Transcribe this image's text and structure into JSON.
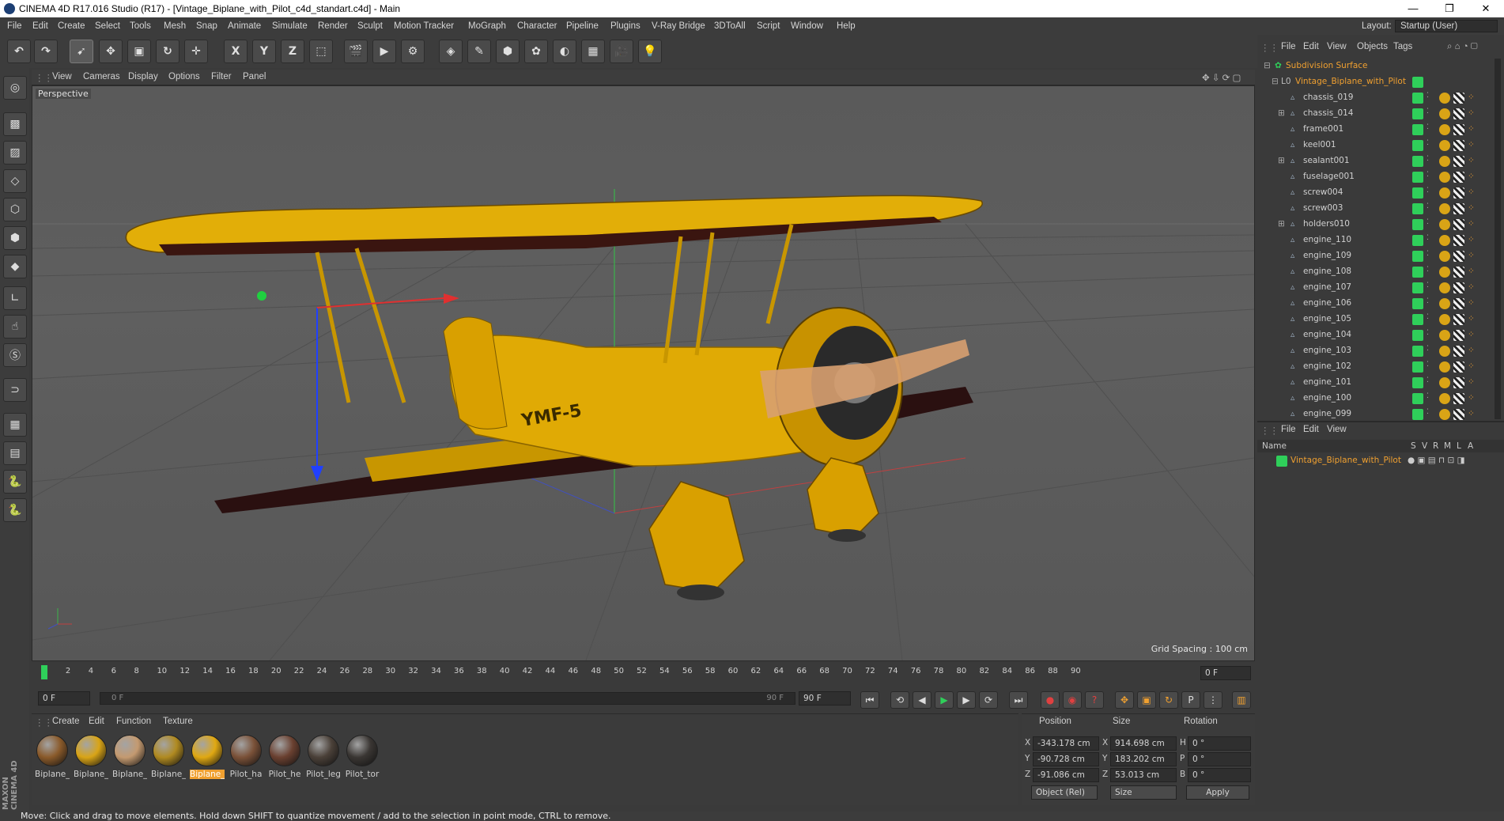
{
  "window": {
    "title": "CINEMA 4D R17.016 Studio (R17) - [Vintage_Biplane_with_Pilot_c4d_standart.c4d] - Main",
    "controls": [
      "—",
      "❐",
      "✕"
    ],
    "layout_label": "Layout:",
    "layout_value": "Startup (User)"
  },
  "menu": [
    "File",
    "Edit",
    "Create",
    "Select",
    "Tools",
    "Mesh",
    "Snap",
    "Animate",
    "Simulate",
    "Render",
    "Sculpt",
    "Motion Tracker",
    "MoGraph",
    "Character",
    "Pipeline",
    "Plugins",
    "V-Ray Bridge",
    "3DToAll",
    "Script",
    "Window",
    "Help"
  ],
  "viewport": {
    "menu": [
      "View",
      "Cameras",
      "Display",
      "Options",
      "Filter",
      "Panel"
    ],
    "label": "Perspective",
    "grid_spacing": "Grid Spacing : 100 cm",
    "plane_text": "YMF-5"
  },
  "timeline": {
    "ticks": [
      "0",
      "2",
      "4",
      "6",
      "8",
      "10",
      "12",
      "14",
      "16",
      "18",
      "20",
      "22",
      "24",
      "26",
      "28",
      "30",
      "32",
      "34",
      "36",
      "38",
      "40",
      "42",
      "44",
      "46",
      "48",
      "50",
      "52",
      "54",
      "56",
      "58",
      "60",
      "62",
      "64",
      "66",
      "68",
      "70",
      "72",
      "74",
      "76",
      "78",
      "80",
      "82",
      "84",
      "86",
      "88",
      "90"
    ],
    "current_frame": "0 F",
    "start": "0 F",
    "slider_start": "0 F",
    "slider_end": "90 F",
    "end": "90 F"
  },
  "materials": {
    "menu": [
      "Create",
      "Edit",
      "Function",
      "Texture"
    ],
    "items": [
      {
        "label": "Biplane_",
        "color": "#8a5a2a"
      },
      {
        "label": "Biplane_",
        "color": "#d9a416"
      },
      {
        "label": "Biplane_",
        "color": "#c49a70"
      },
      {
        "label": "Biplane_",
        "color": "#b08a20"
      },
      {
        "label": "Biplane_",
        "color": "#e0a812"
      },
      {
        "label": "Pilot_ha",
        "color": "#7a5138"
      },
      {
        "label": "Pilot_he",
        "color": "#6a4030"
      },
      {
        "label": "Pilot_leg",
        "color": "#4a4038"
      },
      {
        "label": "Pilot_tor",
        "color": "#3a3633"
      }
    ],
    "selected_index": 4
  },
  "coordinates": {
    "headers": [
      "Position",
      "Size",
      "Rotation"
    ],
    "rows": [
      {
        "axis": "X",
        "pos": "-343.178 cm",
        "size_axis": "X",
        "size": "914.698 cm",
        "rot_axis": "H",
        "rot": "0 °"
      },
      {
        "axis": "Y",
        "pos": "-90.728 cm",
        "size_axis": "Y",
        "size": "183.202 cm",
        "rot_axis": "P",
        "rot": "0 °"
      },
      {
        "axis": "Z",
        "pos": "-91.086 cm",
        "size_axis": "Z",
        "size": "53.013 cm",
        "rot_axis": "B",
        "rot": "0 °"
      }
    ],
    "mode": "Object (Rel)",
    "size_mode": "Size",
    "apply": "Apply"
  },
  "object_manager": {
    "menu": [
      "File",
      "Edit",
      "View",
      "Objects",
      "Tags"
    ],
    "root": "Subdivision Surface",
    "group": "Vintage_Biplane_with_Pilot",
    "objects": [
      "chassis_019",
      "chassis_014",
      "frame001",
      "keel001",
      "sealant001",
      "fuselage001",
      "screw004",
      "screw003",
      "holders010",
      "engine_110",
      "engine_109",
      "engine_108",
      "engine_107",
      "engine_106",
      "engine_105",
      "engine_104",
      "engine_103",
      "engine_102",
      "engine_101",
      "engine_100",
      "engine_099"
    ],
    "expandable": [
      1,
      4,
      8
    ]
  },
  "attribute_manager": {
    "menu": [
      "File",
      "Edit",
      "View"
    ],
    "columns": [
      "Name",
      "S",
      "V",
      "R",
      "M",
      "L",
      "A"
    ],
    "row": "Vintage_Biplane_with_Pilot"
  },
  "status": "Move: Click and drag to move elements. Hold down SHIFT to quantize movement / add to the selection in point mode, CTRL to remove.",
  "brand": "MAXON CINEMA 4D",
  "colors": {
    "accent_orange": "#f0a030",
    "tag_green": "#2fcf5a",
    "plane_yellow": "#e6b000"
  }
}
